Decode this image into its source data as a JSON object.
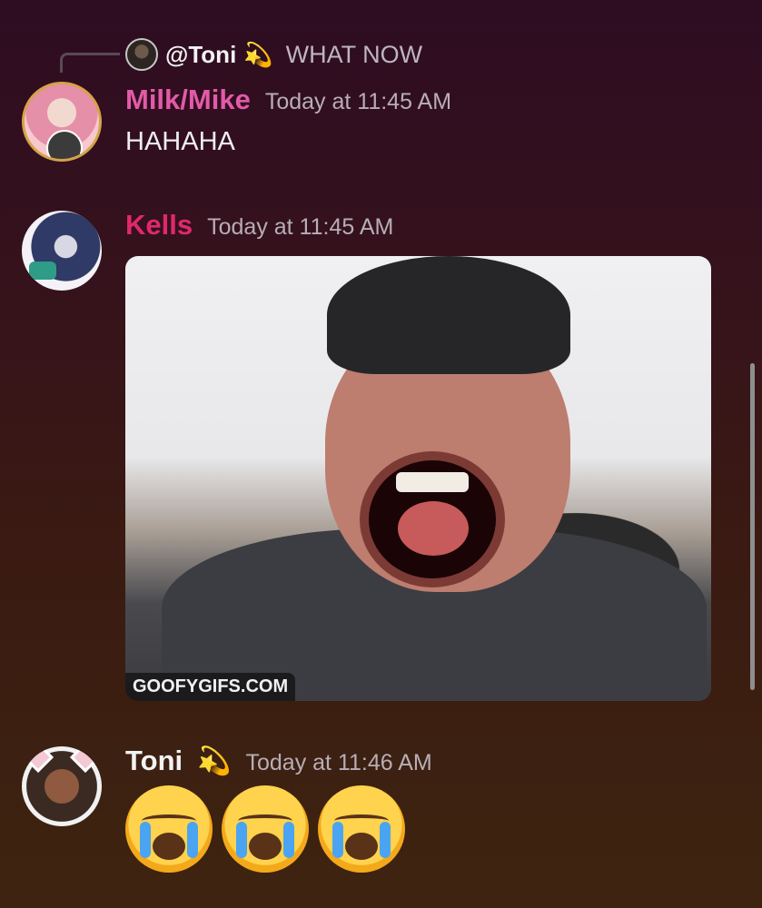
{
  "reply_preview": {
    "mention": "@Toni",
    "emoji": "💫",
    "text": "WHAT NOW"
  },
  "messages": [
    {
      "username": "Milk/Mike",
      "timestamp": "Today at 11:45 AM",
      "content": "HAHAHA",
      "username_color": "#e25aa8"
    },
    {
      "username": "Kells",
      "timestamp": "Today at 11:45 AM",
      "content": "",
      "attachment": {
        "type": "gif",
        "watermark": "GOOFYGIFS.COM"
      },
      "username_color": "#e0286d"
    },
    {
      "username": "Toni",
      "badge_emoji": "💫",
      "timestamp": "Today at 11:46 AM",
      "content_emojis": [
        "😭",
        "😭",
        "😭"
      ],
      "username_color": "#f2f2f2"
    }
  ],
  "icons": {
    "reply_avatar": "toni-avatar-icon",
    "avatar_milk": "milk-mike-avatar",
    "avatar_kells": "kells-avatar",
    "avatar_toni": "toni-avatar",
    "loudly_crying_face": "loudly-crying-face-icon"
  }
}
